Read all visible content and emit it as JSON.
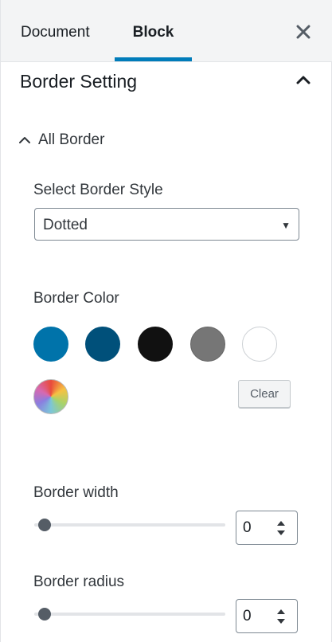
{
  "tabs": [
    {
      "label": "Document",
      "active": false
    },
    {
      "label": "Block",
      "active": true
    }
  ],
  "accent_color": "#007cba",
  "section": {
    "title": "Border Setting",
    "expanded": true
  },
  "subsection": {
    "label": "All Border",
    "expanded": true
  },
  "border_style": {
    "label": "Select Border Style",
    "selected": "Dotted"
  },
  "border_color": {
    "label": "Border Color",
    "swatches": [
      {
        "name": "blue",
        "hex": "#0073aa"
      },
      {
        "name": "dark-blue",
        "hex": "#00507a"
      },
      {
        "name": "black",
        "hex": "#111111"
      },
      {
        "name": "gray",
        "hex": "#767676"
      },
      {
        "name": "white",
        "hex": "#ffffff"
      }
    ],
    "custom_picker": "color-wheel-icon",
    "clear_label": "Clear"
  },
  "border_width": {
    "label": "Border width",
    "value": "0"
  },
  "border_radius": {
    "label": "Border radius",
    "value": "0"
  }
}
